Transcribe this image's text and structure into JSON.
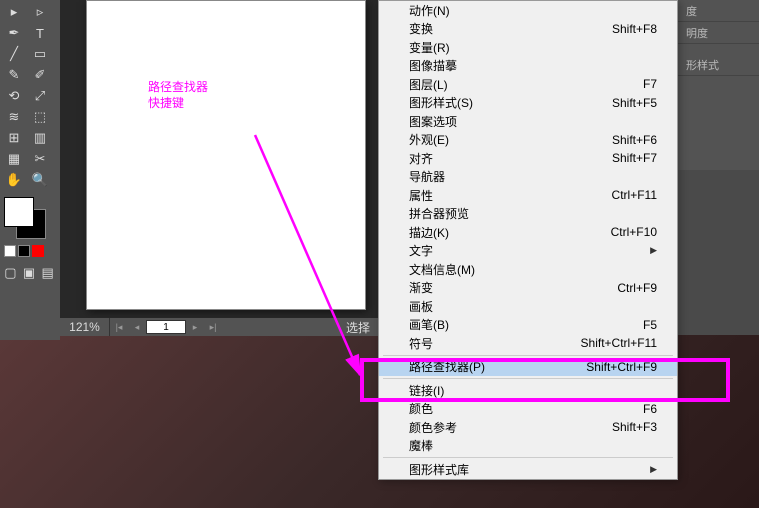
{
  "annotation": {
    "line1": "路径查找器",
    "line2": "快捷键"
  },
  "zoom": "121%",
  "page_input": "1",
  "bottom_text": "选择",
  "right_panels": [
    "度",
    "明度",
    "形样式"
  ],
  "menu_items": [
    {
      "label": "动作(N)",
      "shortcut": "",
      "sep": false,
      "arrow": false
    },
    {
      "label": "变换",
      "shortcut": "Shift+F8",
      "sep": false,
      "arrow": false
    },
    {
      "label": "变量(R)",
      "shortcut": "",
      "sep": false,
      "arrow": false
    },
    {
      "label": "图像描摹",
      "shortcut": "",
      "sep": false,
      "arrow": false
    },
    {
      "label": "图层(L)",
      "shortcut": "F7",
      "sep": false,
      "arrow": false
    },
    {
      "label": "图形样式(S)",
      "shortcut": "Shift+F5",
      "sep": false,
      "arrow": false
    },
    {
      "label": "图案选项",
      "shortcut": "",
      "sep": false,
      "arrow": false
    },
    {
      "label": "外观(E)",
      "shortcut": "Shift+F6",
      "sep": false,
      "arrow": false
    },
    {
      "label": "对齐",
      "shortcut": "Shift+F7",
      "sep": false,
      "arrow": false
    },
    {
      "label": "导航器",
      "shortcut": "",
      "sep": false,
      "arrow": false
    },
    {
      "label": "属性",
      "shortcut": "Ctrl+F11",
      "sep": false,
      "arrow": false
    },
    {
      "label": "拼合器预览",
      "shortcut": "",
      "sep": false,
      "arrow": false
    },
    {
      "label": "描边(K)",
      "shortcut": "Ctrl+F10",
      "sep": false,
      "arrow": false
    },
    {
      "label": "文字",
      "shortcut": "",
      "sep": false,
      "arrow": true
    },
    {
      "label": "文档信息(M)",
      "shortcut": "",
      "sep": false,
      "arrow": false
    },
    {
      "label": "渐变",
      "shortcut": "Ctrl+F9",
      "sep": false,
      "arrow": false
    },
    {
      "label": "画板",
      "shortcut": "",
      "sep": false,
      "arrow": false
    },
    {
      "label": "画笔(B)",
      "shortcut": "F5",
      "sep": false,
      "arrow": false
    },
    {
      "label": "符号",
      "shortcut": "Shift+Ctrl+F11",
      "sep": false,
      "arrow": false
    },
    {
      "sep": true
    },
    {
      "label": "路径查找器(P)",
      "shortcut": "Shift+Ctrl+F9",
      "sep": false,
      "arrow": false,
      "hl": true
    },
    {
      "sep": true
    },
    {
      "label": "链接(I)",
      "shortcut": "",
      "sep": false,
      "arrow": false
    },
    {
      "label": "颜色",
      "shortcut": "F6",
      "sep": false,
      "arrow": false
    },
    {
      "label": "颜色参考",
      "shortcut": "Shift+F3",
      "sep": false,
      "arrow": false
    },
    {
      "label": "魔棒",
      "shortcut": "",
      "sep": false,
      "arrow": false
    },
    {
      "sep": true
    },
    {
      "label": "图形样式库",
      "shortcut": "",
      "sep": false,
      "arrow": true
    }
  ],
  "tools": [
    [
      "↖",
      "✦"
    ],
    [
      "✎",
      "T"
    ],
    [
      "▭",
      "◯"
    ],
    [
      "✐",
      "◪"
    ],
    [
      "↔",
      "⬚"
    ],
    [
      "⊞",
      "📊"
    ],
    [
      "▦",
      "⬛"
    ],
    [
      "✋",
      "🔍"
    ]
  ]
}
